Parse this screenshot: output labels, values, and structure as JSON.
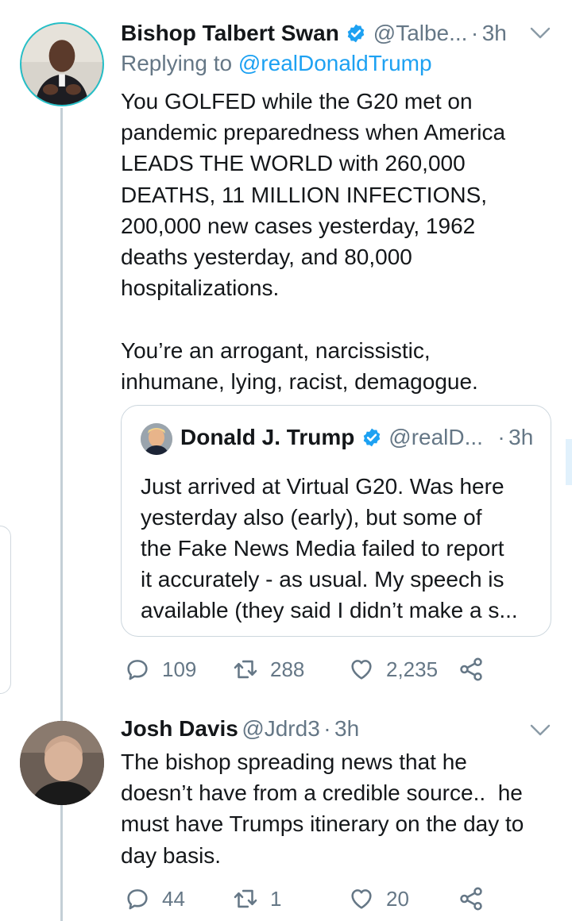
{
  "tweet1": {
    "display_name": "Bishop Talbert Swan",
    "handle": "@Talbe...",
    "separator": "·",
    "time": "3h",
    "replying_prefix": "Replying to",
    "replying_to": "@realDonaldTrump",
    "text": "You GOLFED while the G20 met on\npandemic preparedness when America\nLEADS THE WORLD with 260,000\nDEATHS, 11 MILLION INFECTIONS,\n200,000 new cases yesterday, 1962\ndeaths yesterday, and 80,000\nhospitalizations.\n\nYou’re an arrogant, narcissistic,\ninhumane, lying, racist, demagogue.",
    "quoted": {
      "display_name": "Donald J. Trump",
      "handle": "@realD...",
      "separator": "·",
      "time": "3h",
      "text": "Just arrived at Virtual G20. Was here\nyesterday also (early), but some of\nthe Fake News Media failed to report\nit accurately - as usual. My speech is\navailable (they said I didn’t make a s..."
    },
    "replies": "109",
    "retweets": "288",
    "likes": "2,235"
  },
  "tweet2": {
    "display_name": "Josh Davis",
    "handle": "@Jdrd3",
    "separator": "·",
    "time": "3h",
    "text": "The bishop spreading news that he\ndoesn’t have from a credible source..  he\nmust have Trumps itinerary on the day to\nday basis.",
    "replies": "44",
    "retweets": "1",
    "likes": "20"
  },
  "colors": {
    "link": "#1da1f2",
    "muted": "#657786",
    "text": "#14171a",
    "verified": "#1da1f2"
  }
}
